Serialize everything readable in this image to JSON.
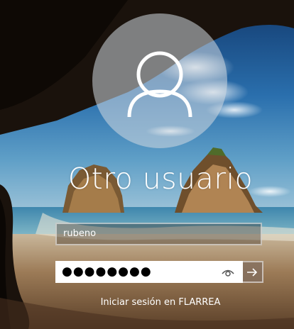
{
  "login": {
    "username": "Otro usuario",
    "user_field_value": "rubeno",
    "password_masked": "●●●●●●●●",
    "sign_in_domain_text": "Iniciar sesión en FLARREA"
  },
  "icons": {
    "avatar": "user-silhouette-icon",
    "reveal": "eye-icon",
    "submit": "arrow-right-icon"
  },
  "colors": {
    "sky_top": "#1d4f86",
    "sea": "#3c7fa6",
    "sand": "#8a6a48",
    "cave_dark": "#1a120c"
  }
}
